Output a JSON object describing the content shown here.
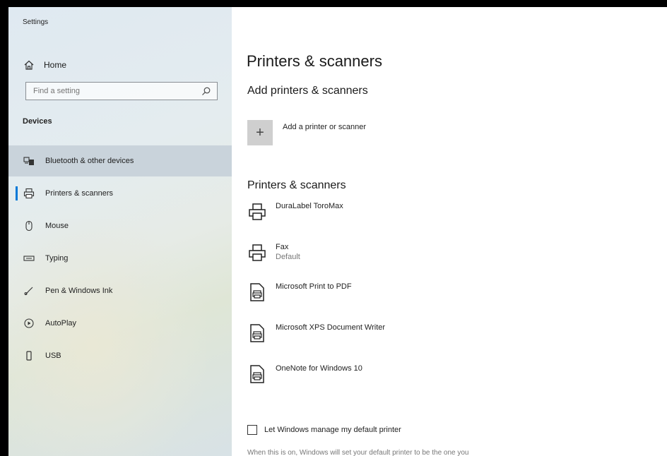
{
  "app": {
    "title": "Settings"
  },
  "sidebar": {
    "home_label": "Home",
    "search_placeholder": "Find a setting",
    "section_title": "Devices",
    "items": [
      {
        "label": "Bluetooth & other devices",
        "icon": "bluetooth-devices-icon"
      },
      {
        "label": "Printers & scanners",
        "icon": "printer-icon"
      },
      {
        "label": "Mouse",
        "icon": "mouse-icon"
      },
      {
        "label": "Typing",
        "icon": "keyboard-icon"
      },
      {
        "label": "Pen & Windows Ink",
        "icon": "pen-icon"
      },
      {
        "label": "AutoPlay",
        "icon": "autoplay-icon"
      },
      {
        "label": "USB",
        "icon": "usb-icon"
      }
    ]
  },
  "main": {
    "page_title": "Printers & scanners",
    "add_section_title": "Add printers & scanners",
    "add_button_label": "Add a printer or scanner",
    "list_section_title": "Printers & scanners",
    "devices": [
      {
        "name": "DuraLabel ToroMax",
        "sub": "",
        "icon": "printer-icon"
      },
      {
        "name": "Fax",
        "sub": "Default",
        "icon": "printer-icon"
      },
      {
        "name": "Microsoft Print to PDF",
        "sub": "",
        "icon": "document-printer-icon"
      },
      {
        "name": "Microsoft XPS Document Writer",
        "sub": "",
        "icon": "document-printer-icon"
      },
      {
        "name": "OneNote for Windows 10",
        "sub": "",
        "icon": "document-printer-icon"
      }
    ],
    "manage_default_label": "Let Windows manage my default printer",
    "manage_default_checked": false,
    "helper_text": "When this is on, Windows will set your default printer to be the one you"
  },
  "colors": {
    "accent": "#0078d7",
    "selected_bg": "#c9d3db"
  }
}
